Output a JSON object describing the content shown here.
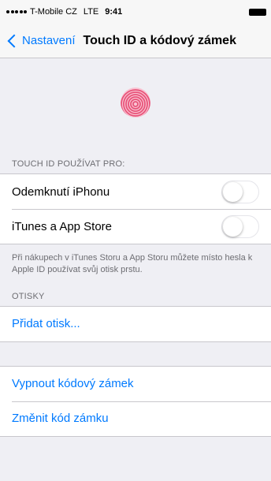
{
  "status_bar": {
    "carrier": "T-Mobile CZ",
    "network": "LTE",
    "time": "9:41"
  },
  "nav": {
    "back_label": "Nastavení",
    "title": "Touch ID a kódový zámek"
  },
  "touch_id_section": {
    "header": "TOUCH ID POUŽÍVAT PRO:",
    "items": [
      {
        "label": "Odemknutí iPhonu",
        "enabled": false
      },
      {
        "label": "iTunes a App Store",
        "enabled": false
      }
    ],
    "footer": "Při nákupech v iTunes Storu a App Storu můžete místo hesla k Apple ID používat svůj otisk prstu."
  },
  "fingerprints_section": {
    "header": "OTISKY",
    "add_label": "Přidat otisk..."
  },
  "passcode_section": {
    "turn_off_label": "Vypnout kódový zámek",
    "change_label": "Změnit kód zámku"
  },
  "colors": {
    "accent": "#007aff",
    "fingerprint": "#e8547a",
    "carrier_brand": "#e5097f"
  }
}
